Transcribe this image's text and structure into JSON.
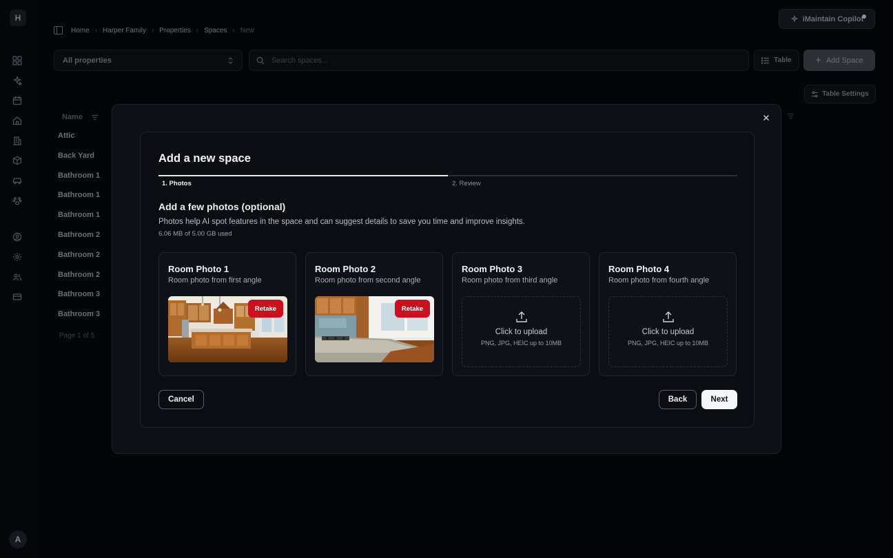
{
  "sidebar": {
    "logo": "H",
    "avatar": "A",
    "icons": [
      "dashboard-icon",
      "sparkles-icon",
      "calendar-icon",
      "home-icon",
      "building-icon",
      "box-icon",
      "car-icon",
      "paw-icon",
      "user-circle-icon",
      "settings-icon",
      "users-icon",
      "credit-card-icon"
    ]
  },
  "breadcrumb": {
    "items": [
      "Home",
      "Harper Family",
      "Properties",
      "Spaces"
    ],
    "current": "New"
  },
  "copilot": {
    "label": "iMaintain Copilot"
  },
  "toolbar": {
    "property_select": "All properties",
    "search_placeholder": "Search spaces...",
    "table_label": "Table",
    "add_label": "Add Space",
    "settings_label": "Table Settings"
  },
  "table": {
    "column": "Name",
    "rows": [
      "Attic",
      "Back Yard",
      "Bathroom 1",
      "Bathroom 1",
      "Bathroom 1",
      "Bathroom 2",
      "Bathroom 2",
      "Bathroom 2",
      "Bathroom 3",
      "Bathroom 3"
    ],
    "pager": "Page 1 of 5"
  },
  "modal": {
    "title": "Add a new space",
    "steps": [
      "1. Photos",
      "2. Review"
    ],
    "active_step_progress": 0.5,
    "section_title": "Add a few photos (optional)",
    "section_desc": "Photos help AI spot features in the space and can suggest details to save you time and improve insights.",
    "storage": "6.06 MB of 5.00 GB used",
    "cards": [
      {
        "title": "Room Photo 1",
        "subtitle": "Room photo from first angle",
        "retake": "Retake"
      },
      {
        "title": "Room Photo 2",
        "subtitle": "Room photo from second angle",
        "retake": "Retake"
      },
      {
        "title": "Room Photo 3",
        "subtitle": "Room photo from third angle",
        "upload": "Click to upload",
        "formats": "PNG, JPG, HEIC up to 10MB"
      },
      {
        "title": "Room Photo 4",
        "subtitle": "Room photo from fourth angle",
        "upload": "Click to upload",
        "formats": "PNG, JPG, HEIC up to 10MB"
      }
    ],
    "cancel": "Cancel",
    "back": "Back",
    "next": "Next"
  },
  "colors": {
    "accent_red": "#c8101e",
    "background": "#05070b",
    "primary_button": "#f5f6f8"
  }
}
